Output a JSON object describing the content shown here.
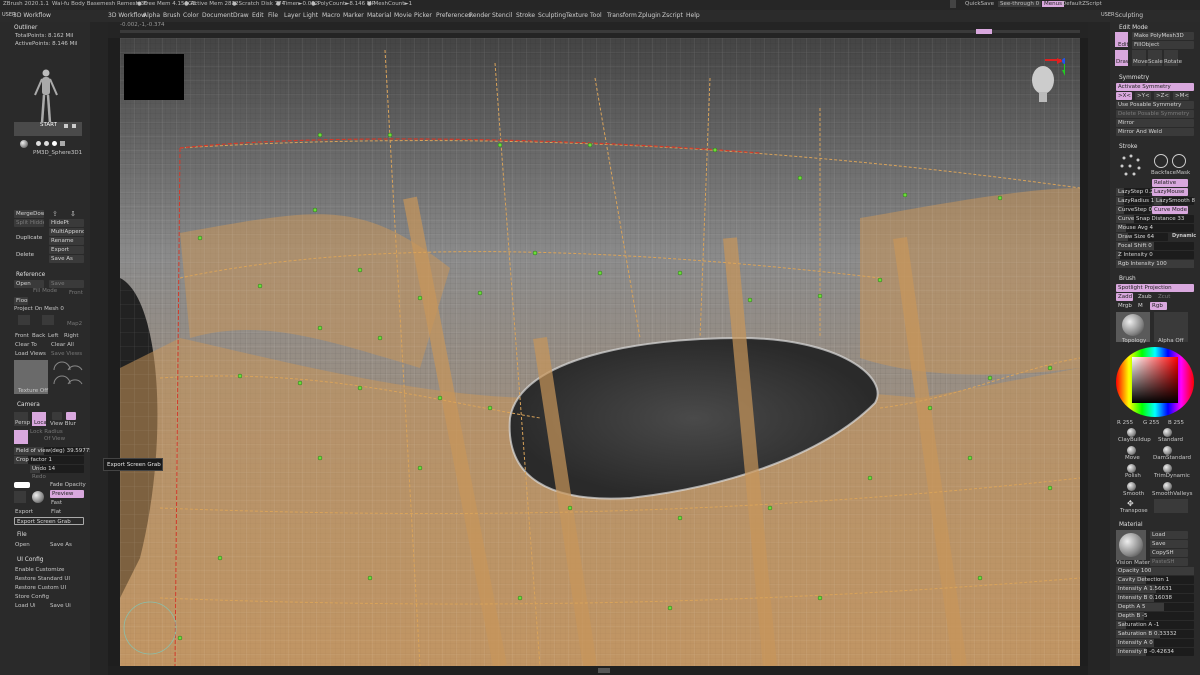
{
  "titlebar": {
    "app": "ZBrush 2020.1.1",
    "doc": "Wai-fu Body Basemesh Remesh 30",
    "free_mem": "● Free Mem 4.156GB",
    "active_mem": "● Active Mem 2812",
    "scratch": "● Scratch Disk 774",
    "timer": "● Timer►0.002",
    "polycount": "● PolyCount►8.146 MP",
    "meshcount": "● MeshCount►1",
    "quicksave": "QuickSave",
    "see_through": "See-through  0",
    "menus": "Menus",
    "script": "DefaultZScript"
  },
  "menubar": {
    "user": "USER",
    "workflow": "3D Workflow",
    "items": [
      "3D Workflow",
      "Alpha",
      "Brush",
      "Color",
      "Document",
      "Draw",
      "Edit",
      "File",
      "Layer",
      "Light",
      "Macro",
      "Marker",
      "Material",
      "Movie",
      "Picker",
      "Preferences",
      "Render",
      "Stencil",
      "Stroke",
      "Sculpting",
      "Texture",
      "Tool",
      "Transform",
      "Zplugin",
      "Zscript",
      "Help"
    ],
    "right_user": "USER",
    "right_title": "Sculpting"
  },
  "coords": "-0.002,-1,-0.374",
  "tooltip": "Export Screen Grab",
  "left": {
    "outliner": "Outliner",
    "total_points": "TotalPoints: 8.162 Mil",
    "active_points": "ActivePoints: 8.146 Mil",
    "subtool_name": "PM3D_Sphere3D1",
    "start": "START",
    "merge_down": "MergeDown",
    "split_hidden": "Split Hidden",
    "hide_pt": "HidePt",
    "duplicate": "Duplicate",
    "multiappend": "MultiAppend",
    "rename": "Rename",
    "delete": "Delete",
    "export": "Export",
    "save_as": "Save As",
    "reference": "Reference",
    "open": "Open",
    "save": "Save",
    "fill_mode": "Fill Mode",
    "front": "Front",
    "floor": "Floor",
    "project_on_mesh": "Project On Mesh  0",
    "map2": "Map2",
    "views": [
      "Front",
      "Back",
      "Left",
      "Right"
    ],
    "clear_to": "Clear To",
    "clear_all": "Clear All",
    "load_views": "Load Views",
    "save_views": "Save Views",
    "texture_off": "Texture Off",
    "camera": "Camera",
    "persp": "Persp",
    "local": "Local",
    "view_blur": "View Blur",
    "lock_radius": "Lock Radius",
    "of_view": "Of View",
    "field_of_view": "Field of view(deg)  39.59775",
    "crop_factor": "Crop factor  1",
    "undo": "Undo  14",
    "redo": "Redo",
    "fade_opacity": "Fade Opacity",
    "preview": "Preview",
    "fast": "Fast",
    "flat": "Flat",
    "export_btn": "Export",
    "export_grab": "Export Screen Grab",
    "file": "File",
    "file_open": "Open",
    "file_save_as": "Save As",
    "ui_config": "UI Config",
    "enable_customize": "Enable Customize",
    "restore_standard": "Restore Standard UI",
    "restore_custom": "Restore Custom UI",
    "store_config": "Store Config",
    "load_ui": "Load Ui",
    "save_ui": "Save Ui"
  },
  "right": {
    "edit_mode": "Edit Mode",
    "make_polymesh": "Make PolyMesh3D",
    "fill_object": "FillObject",
    "edit": "Edit",
    "draw": "Draw",
    "move": "Move",
    "scale": "Scale",
    "rotate": "Rotate",
    "symmetry": "Symmetry",
    "activate_symmetry": "Activate Symmetry",
    "axes": [
      ">X<",
      ">Y<",
      ">Z<",
      ">M<"
    ],
    "use_posable": "Use Posable Symmetry",
    "delete_posable": "Delete Posable Symmetry",
    "mirror": "Mirror",
    "mirror_weld": "Mirror And Weld",
    "stroke": "Stroke",
    "backface_mask": "BackfaceMask",
    "relative": "Relative",
    "lazystep": "LazyStep 0.25",
    "lazymouse": "LazyMouse",
    "lazyradius": "LazyRadius 13",
    "lazysmooth": "LazySmooth 8",
    "curvestep": "CurveStep 0.2",
    "curve_mode": "Curve Mode",
    "curve_snap": "Curve Snap Distance 33",
    "mouse_avg": "Mouse Avg 4",
    "draw_size": "Draw Size 64",
    "dynamic": "Dynamic",
    "focal_shift": "Focal Shift 0",
    "z_intensity": "Z Intensity 0",
    "rgb_intensity": "Rgb Intensity 100",
    "brush": "Brush",
    "spotlight": "Spotlight Projection",
    "zadd": "Zadd",
    "zsub": "Zsub",
    "zcut": "Zcut",
    "mrgb": "Mrgb",
    "m": "M",
    "rgb": "Rgb",
    "topology": "Topology",
    "alpha_off": "Alpha Off",
    "r": "R 255",
    "g": "G 255",
    "b": "B 255",
    "brushes": [
      "ClayBuildup",
      "Standard",
      "Move",
      "DamStandard",
      "Polish",
      "TrimDynamic",
      "Smooth",
      "SmoothValleys",
      "Transpose"
    ],
    "material": "Material",
    "load": "Load",
    "save": "Save",
    "copysh": "CopySH",
    "pastesh": "PasteSH",
    "vision_material": "Vision Material",
    "opacity": "Opacity 100",
    "cavity_detection": "Cavity Detection 1",
    "intensity_a": "Intensity A 1.56631",
    "intensity_b": "Intensity B 0.16038",
    "depth_a": "Depth A 5",
    "depth_b": "Depth B -5",
    "saturation_a": "Saturation A -1",
    "saturation_b": "Saturation B 0.33332",
    "intensity_a2": "Intensity A 0",
    "intensity_b2": "Intensity B -0.42634"
  },
  "colors": {
    "accent": "#d9a8de",
    "panel": "#2a2a2a",
    "orange_poly": "#c8955a",
    "dot_green": "#6bdc3a",
    "curve_red": "#d23a2a"
  }
}
